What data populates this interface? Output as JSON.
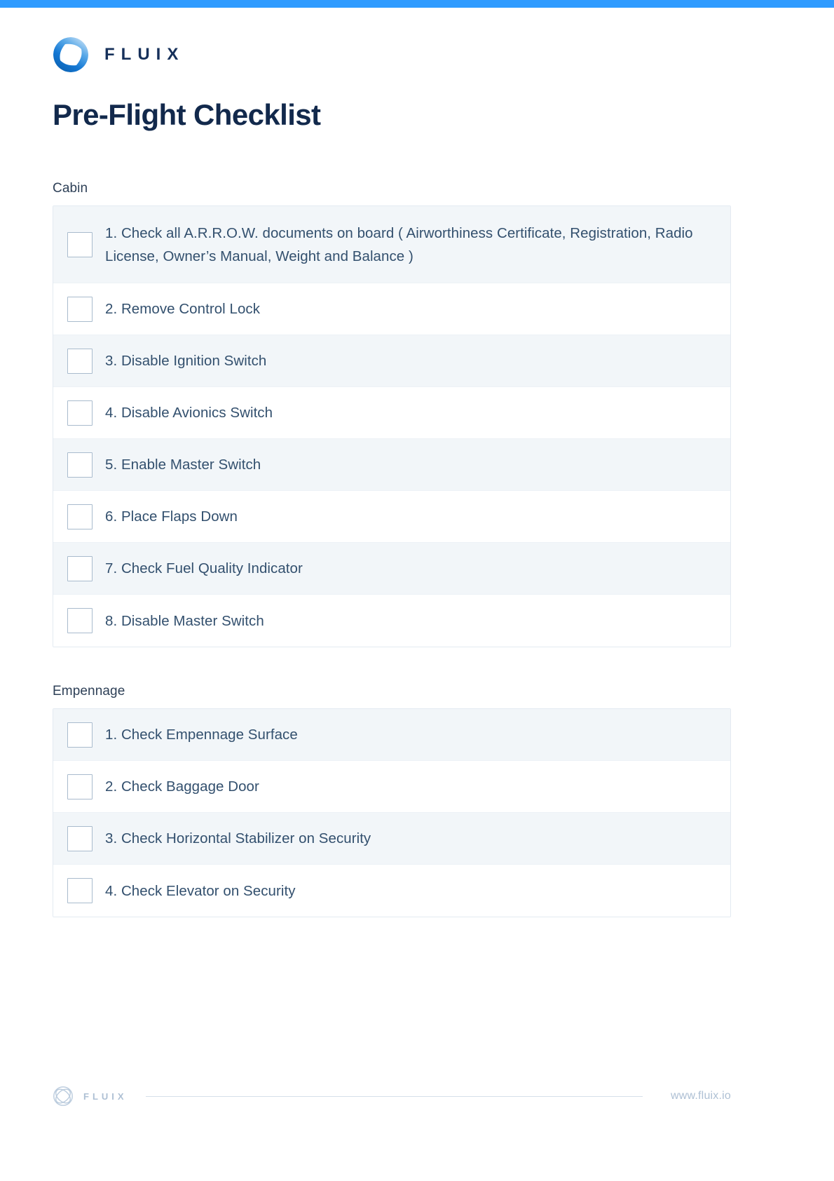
{
  "theme": {
    "accent_bar": "#2F9BFF",
    "title_color": "#12294C",
    "row_alt_background": "#F2F6F9",
    "row_text_color": "#33506E",
    "footer_muted": "#AEC0D4"
  },
  "header": {
    "logo_icon": "fluix-ring-logo-icon",
    "brand": "FLUIX",
    "title": "Pre-Flight Checklist"
  },
  "sections": [
    {
      "label": "Cabin",
      "items": [
        {
          "text": "1. Check all A.R.R.O.W. documents on board ( Airworthiness Certificate, Registration, Radio License, Owner’s Manual, Weight and Balance )",
          "checked": false
        },
        {
          "text": "2. Remove Control Lock",
          "checked": false
        },
        {
          "text": "3. Disable Ignition Switch",
          "checked": false
        },
        {
          "text": "4. Disable Avionics Switch",
          "checked": false
        },
        {
          "text": "5. Enable Master Switch",
          "checked": false
        },
        {
          "text": "6. Place Flaps Down",
          "checked": false
        },
        {
          "text": "7. Check Fuel Quality Indicator",
          "checked": false
        },
        {
          "text": "8. Disable Master Switch",
          "checked": false
        }
      ]
    },
    {
      "label": "Empennage",
      "items": [
        {
          "text": "1. Check Empennage Surface",
          "checked": false
        },
        {
          "text": "2. Check Baggage Door",
          "checked": false
        },
        {
          "text": "3. Check Horizontal Stabilizer on Security",
          "checked": false
        },
        {
          "text": "4. Check Elevator on Security",
          "checked": false
        }
      ]
    }
  ],
  "footer": {
    "logo_icon": "fluix-ring-outline-logo-icon",
    "brand": "FLUIX",
    "url": "www.fluix.io"
  }
}
